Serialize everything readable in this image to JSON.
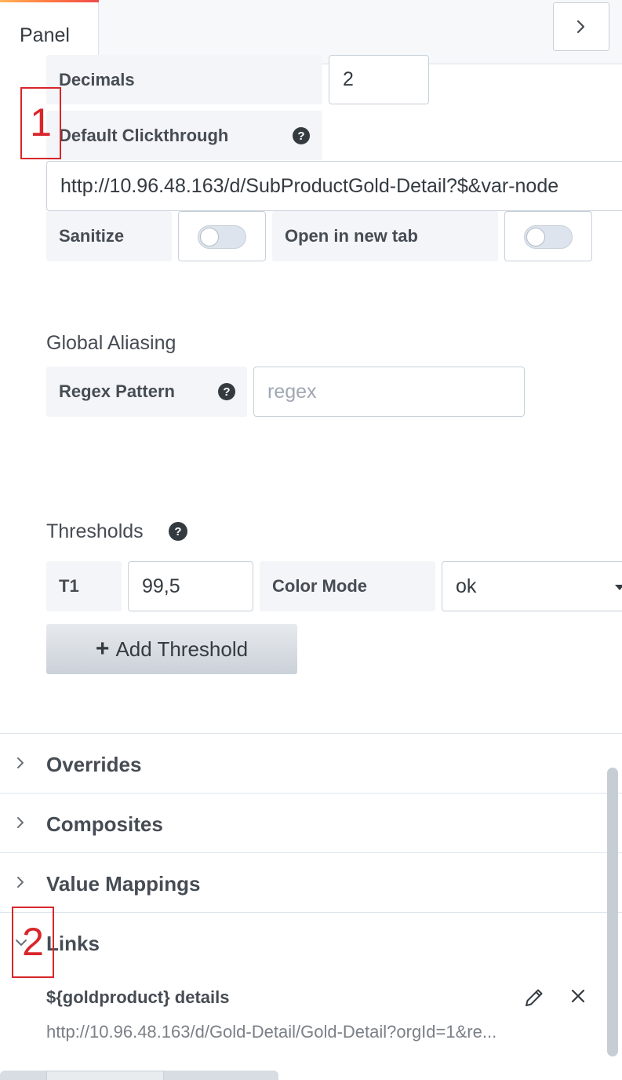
{
  "tabs": {
    "panel": "Panel"
  },
  "options": {
    "decimals_label": "Decimals",
    "decimals_value": "2",
    "default_clickthrough_label": "Default Clickthrough",
    "clickthrough_url": "http://10.96.48.163/d/SubProductGold-Detail?$&var-node",
    "sanitize_label": "Sanitize",
    "open_new_tab_label": "Open in new tab"
  },
  "aliasing": {
    "title": "Global Aliasing",
    "regex_label": "Regex Pattern",
    "regex_placeholder": "regex"
  },
  "thresholds": {
    "title": "Thresholds",
    "t1_label": "T1",
    "t1_value": "99,5",
    "color_mode_label": "Color Mode",
    "color_mode_value": "ok",
    "add_button": "Add Threshold"
  },
  "sections": {
    "overrides": "Overrides",
    "composites": "Composites",
    "value_mappings": "Value Mappings",
    "links": "Links"
  },
  "links": {
    "item_title": "${goldproduct} details",
    "item_url": "http://10.96.48.163/d/Gold-Detail/Gold-Detail?orgId=1&re..."
  },
  "annotations": {
    "first": "1",
    "second": "2"
  },
  "colors": {
    "accent_start": "#ffb357",
    "accent_end": "#f04949",
    "annotation": "#d9262b"
  }
}
